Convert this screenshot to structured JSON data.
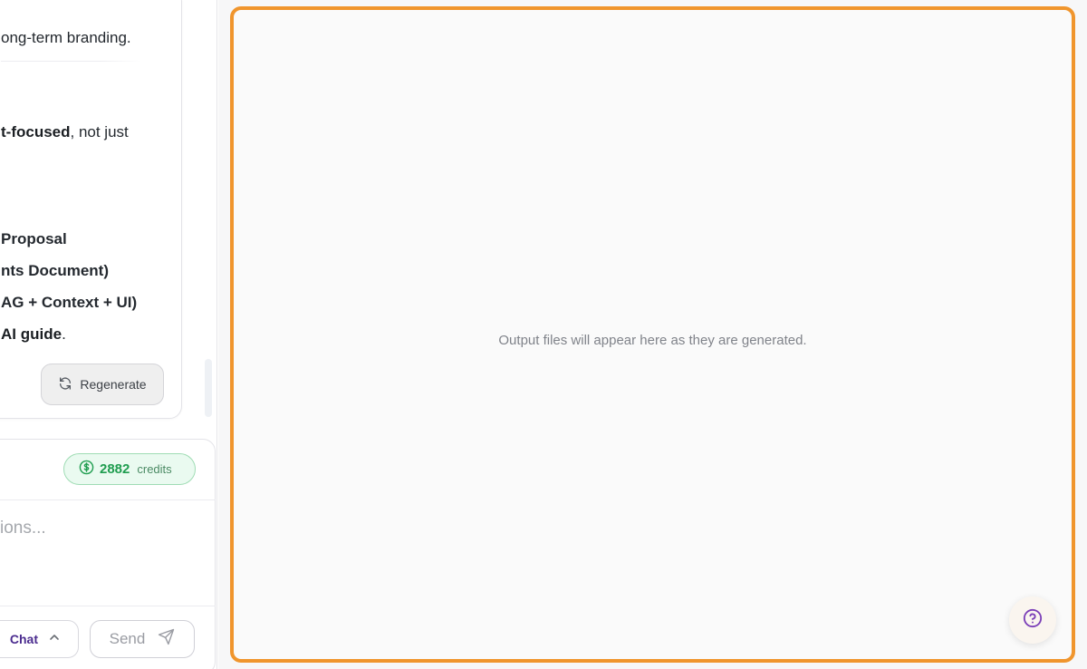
{
  "chat": {
    "lines": {
      "l1": "ong-term branding.",
      "l2_bold": "t-focused",
      "l2_rest": ", not just",
      "l3": "Proposal",
      "l4": "nts Document)",
      "l5": "AG + Context + UI)",
      "l6_bold": "AI guide",
      "l6_rest": "."
    },
    "regenerate_label": "Regenerate"
  },
  "composer": {
    "credits_value": "2882",
    "credits_label": "credits",
    "input_text": "ions...",
    "mode_label": "Chat",
    "send_label": "Send"
  },
  "output": {
    "empty_message": "Output files will appear here as they are generated."
  },
  "colors": {
    "accent_border": "#f0952d",
    "credits_green": "#1f9d4f",
    "mode_purple": "#4b2c8f"
  },
  "icons": {
    "regenerate": "refresh-icon",
    "credits": "dollar-coin-icon",
    "mode": "chevron-up-icon",
    "send": "send-icon",
    "help": "help-circle-icon"
  }
}
